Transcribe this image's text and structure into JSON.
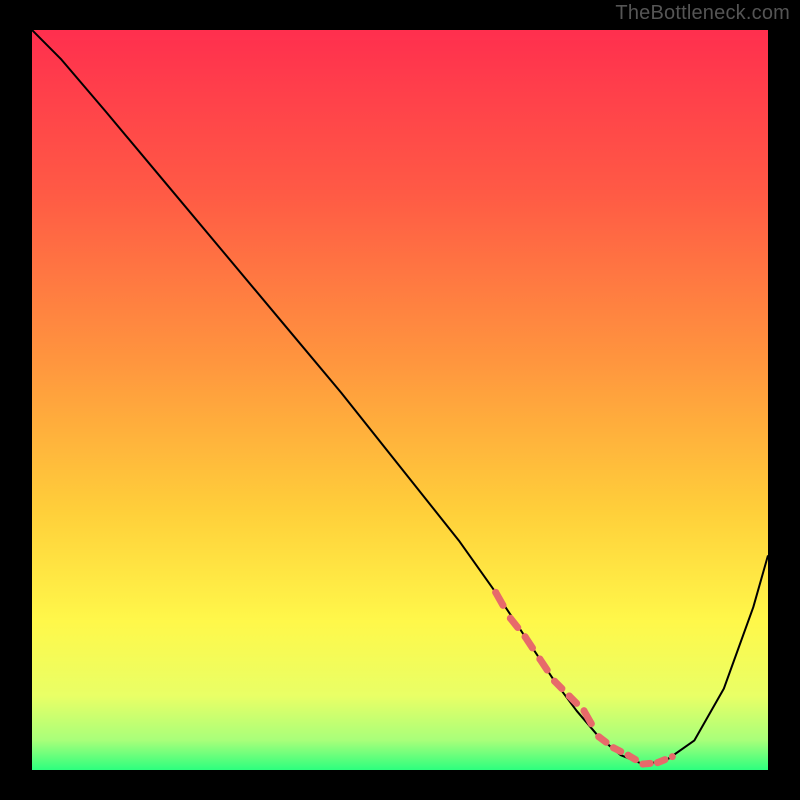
{
  "watermark": "TheBottleneck.com",
  "chart_data": {
    "type": "line",
    "title": "",
    "xlabel": "",
    "ylabel": "",
    "xlim": [
      0,
      100
    ],
    "ylim": [
      0,
      100
    ],
    "background_gradient": {
      "stops": [
        {
          "offset": 0,
          "color": "#ff2f4e"
        },
        {
          "offset": 22,
          "color": "#ff5a45"
        },
        {
          "offset": 45,
          "color": "#ff963e"
        },
        {
          "offset": 65,
          "color": "#ffcf3a"
        },
        {
          "offset": 80,
          "color": "#fff84a"
        },
        {
          "offset": 90,
          "color": "#e9ff66"
        },
        {
          "offset": 96,
          "color": "#a8ff7a"
        },
        {
          "offset": 100,
          "color": "#2dff7e"
        }
      ]
    },
    "series": [
      {
        "name": "bottleneck-curve",
        "x": [
          0,
          4,
          10,
          18,
          26,
          34,
          42,
          50,
          58,
          63,
          67,
          71,
          74,
          77,
          80,
          83,
          86,
          90,
          94,
          98,
          100
        ],
        "y": [
          100,
          96,
          89,
          79.5,
          70,
          60.5,
          51,
          41,
          31,
          24,
          18,
          12,
          8,
          4.5,
          2,
          0.8,
          1.2,
          4,
          11,
          22,
          29
        ],
        "stroke": "#000000",
        "stroke_width": 2
      },
      {
        "name": "optimal-zone-markers",
        "x": [
          63,
          65,
          67,
          69,
          71,
          73,
          75,
          77,
          79,
          81,
          83,
          85,
          87
        ],
        "y": [
          24,
          20.5,
          18,
          15,
          12,
          10,
          8,
          4.5,
          3,
          2,
          0.8,
          1,
          1.8
        ],
        "stroke": "#e76a6a",
        "stroke_width": 7,
        "style": "dotted"
      }
    ]
  }
}
